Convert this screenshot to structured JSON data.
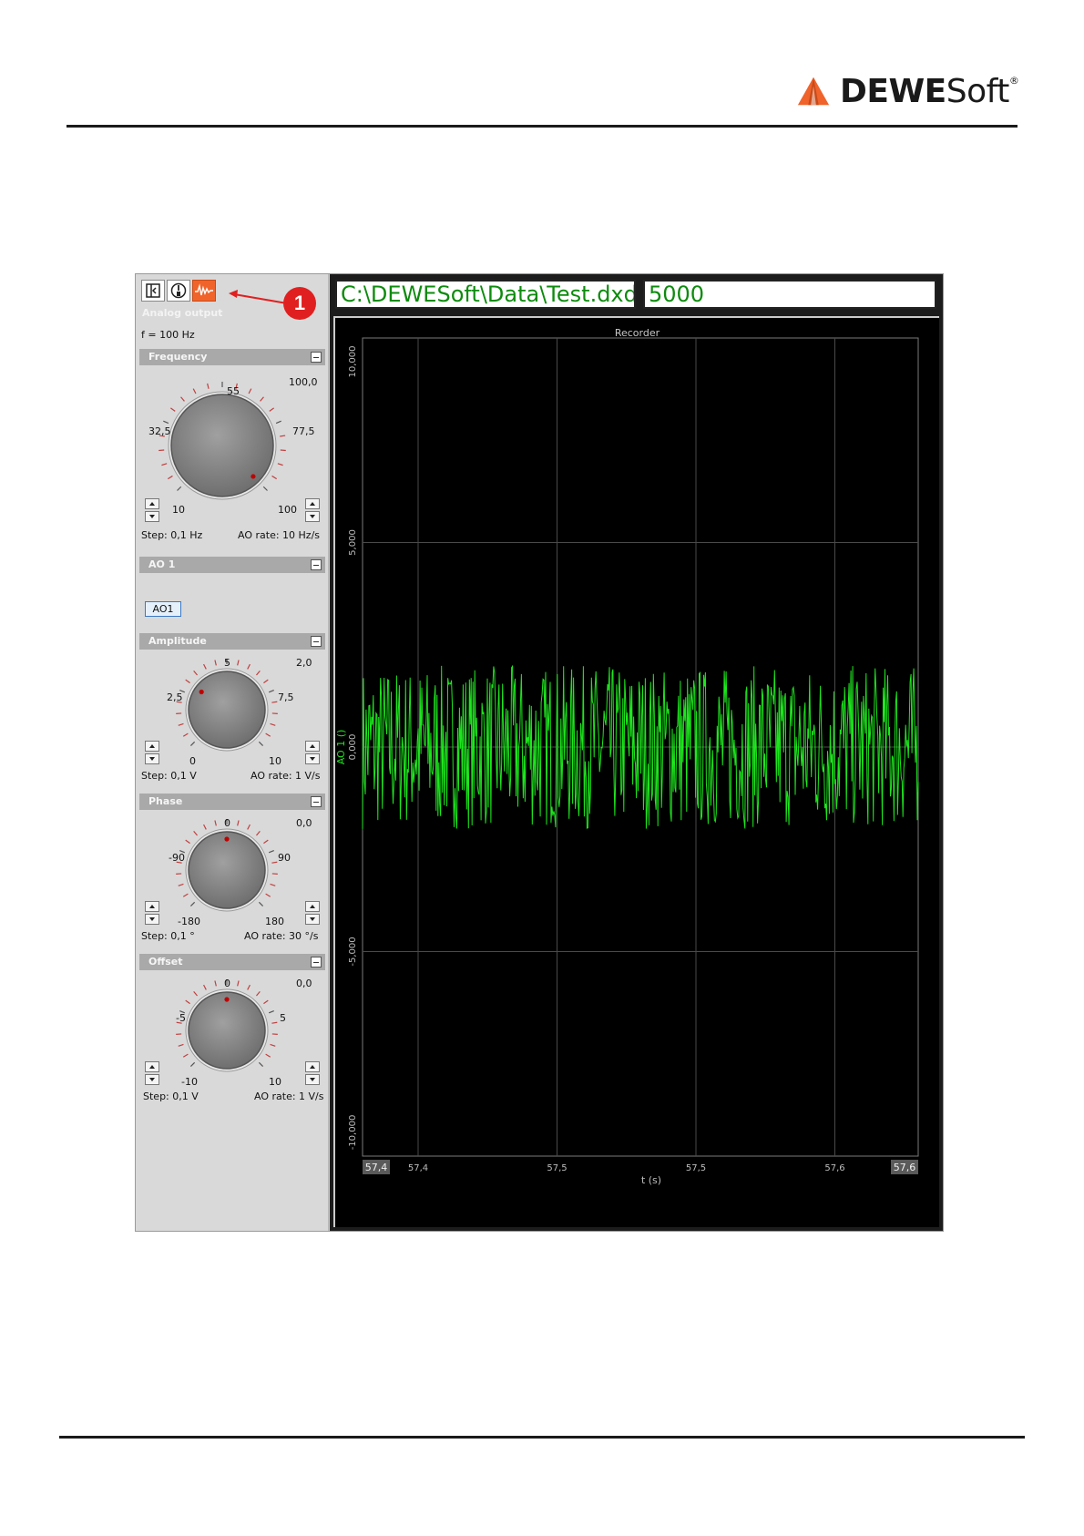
{
  "header": {
    "logo_text_bold": "DEWE",
    "logo_text_regular": "Soft",
    "logo_reg": "®",
    "logo_color": "#f0632a"
  },
  "toolbar": {
    "icons": [
      "panel-toggle-icon",
      "gauge-icon",
      "analog-output-waveform-icon"
    ],
    "callout": "1"
  },
  "left_panel": {
    "title": "Analog output",
    "frequency_readout": "f = 100 Hz",
    "sections": {
      "frequency": {
        "title": "Frequency",
        "min_label": "10",
        "max_label": "100",
        "q1_label": "32,5",
        "mid_label": "55",
        "q3_label": "77,5",
        "value": "100,0",
        "step": "Step: 0,1 Hz",
        "rate": "AO rate: 10 Hz/s"
      },
      "ao1": {
        "title": "AO 1",
        "chip": "AO1"
      },
      "amplitude": {
        "title": "Amplitude",
        "min_label": "0",
        "max_label": "10",
        "q1_label": "2,5",
        "mid_label": "5",
        "q3_label": "7,5",
        "value": "2,0",
        "step": "Step: 0,1 V",
        "rate": "AO rate: 1 V/s"
      },
      "phase": {
        "title": "Phase",
        "min_label": "-180",
        "max_label": "180",
        "q1_label": "-90",
        "mid_label": "0",
        "q3_label": "90",
        "value": "0,0",
        "step": "Step: 0,1 °",
        "rate": "AO rate: 30 °/s"
      },
      "offset": {
        "title": "Offset",
        "min_label": "-10",
        "max_label": "10",
        "q1_label": "-5",
        "mid_label": "0",
        "q3_label": "5",
        "value": "0,0",
        "step": "Step: 0,1 V",
        "rate": "AO rate: 1 V/s"
      }
    }
  },
  "top_fields": {
    "file_path": "C:\\DEWESoft\\Data\\Test.dxd",
    "value": "5000"
  },
  "recorder": {
    "title": "Recorder",
    "y_ticks": [
      "10,000",
      "5,000",
      "0,000",
      "-5,000",
      "-10,000"
    ],
    "x_ticks": [
      "57,4",
      "57,5",
      "57,5",
      "57,6"
    ],
    "x_start": "57,4",
    "x_end": "57,6",
    "x_label": "t (s)",
    "y_label": "AO 1 ()",
    "signal_color": "#1ee61e"
  },
  "chart_data": {
    "type": "line",
    "title": "Recorder",
    "xlabel": "t (s)",
    "ylabel": "AO 1 ()",
    "xlim": [
      57.4,
      57.6
    ],
    "ylim": [
      -10,
      10
    ],
    "series": [
      {
        "name": "AO 1",
        "signal_range": [
          -2,
          2
        ]
      }
    ],
    "grid": true
  }
}
